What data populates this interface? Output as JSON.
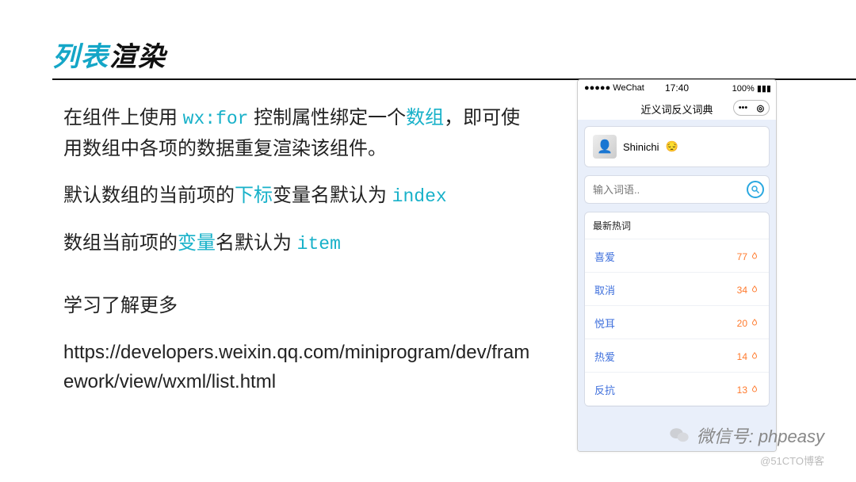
{
  "heading": {
    "part1": "列表",
    "part2": "渲染"
  },
  "paragraphs": {
    "p1a": "在组件上使用 ",
    "p1_code": "wx:for",
    "p1b": " 控制属性绑定一个",
    "p1_hi": "数组",
    "p1c": "，即可使用数组中各项的数据重复渲染该组件。",
    "p2a": "默认数组的当前项的",
    "p2_hi": "下标",
    "p2b": "变量名默认为 ",
    "p2_code": "index",
    "p3a": "数组当前项的",
    "p3_hi": "变量",
    "p3b": "名默认为 ",
    "p3_code": "item"
  },
  "learn": {
    "title": "学习了解更多",
    "url": "https://developers.weixin.qq.com/miniprogram/dev/framework/view/wxml/list.html"
  },
  "phone": {
    "status": {
      "left": "●●●●● WeChat",
      "time": "17:40",
      "right": "100%  ▮▮▮"
    },
    "appTitle": "近义词反义词典",
    "headerIcons": {
      "dots": "•••",
      "target": "◎"
    },
    "user": {
      "name": "Shinichi",
      "emoji": "😔"
    },
    "search": {
      "placeholder": "输入词语.."
    },
    "listHeader": "最新热词",
    "items": [
      {
        "word": "喜爱",
        "count": "77"
      },
      {
        "word": "取消",
        "count": "34"
      },
      {
        "word": "悦耳",
        "count": "20"
      },
      {
        "word": "热爱",
        "count": "14"
      },
      {
        "word": "反抗",
        "count": "13"
      }
    ]
  },
  "watermark": {
    "line": "微信号: phpeasy",
    "sub": "@51CTO博客"
  }
}
